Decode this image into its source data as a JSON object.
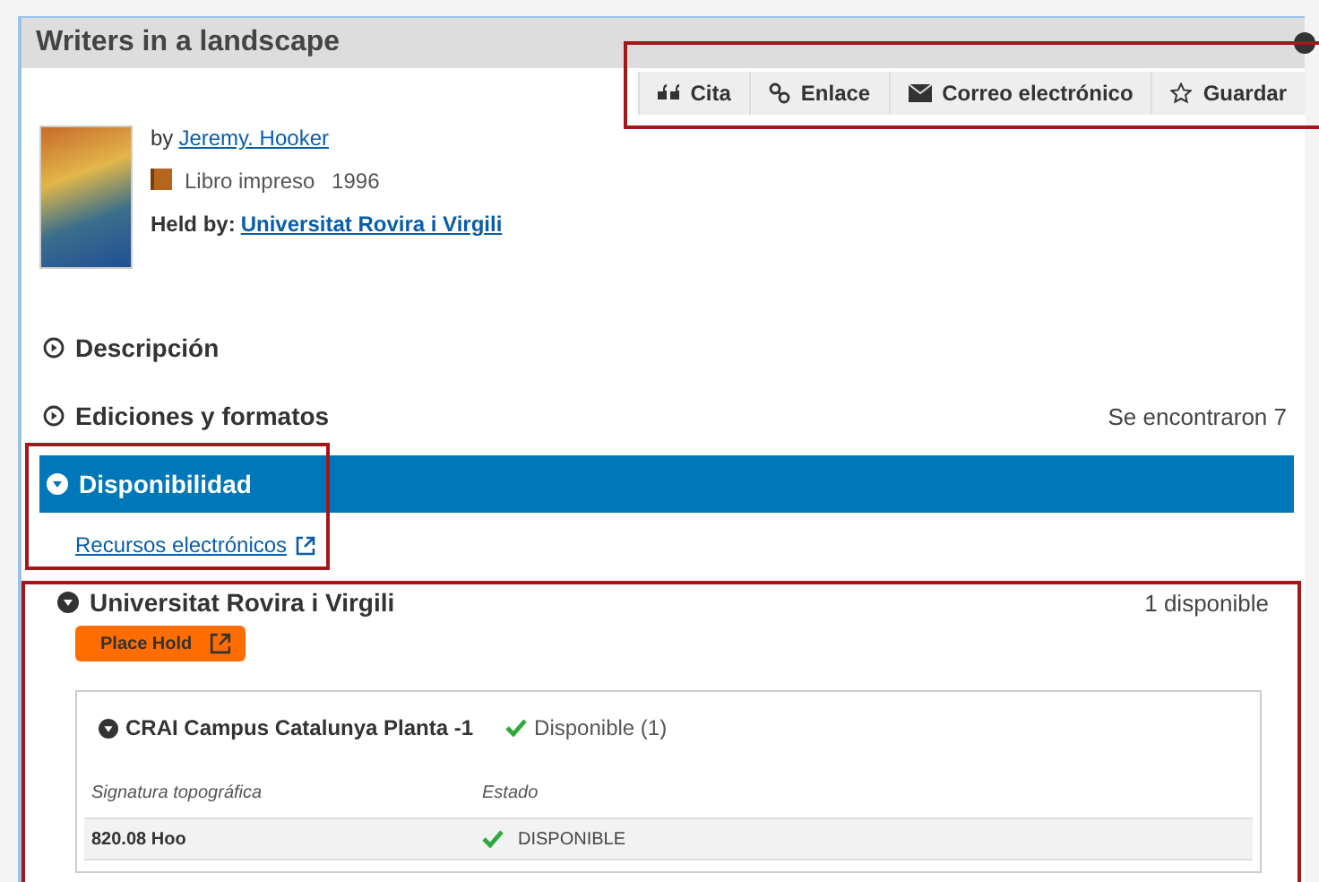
{
  "title": "Writers in a landscape",
  "actions": [
    {
      "label": "Cita",
      "kind": "quote"
    },
    {
      "label": "Enlace",
      "kind": "link"
    },
    {
      "label": "Correo electrónico",
      "kind": "mail"
    },
    {
      "label": "Guardar",
      "kind": "star"
    }
  ],
  "record": {
    "by_prefix": "by",
    "author": "Jeremy. Hooker",
    "format": "Libro impreso",
    "year": "1996",
    "held_by_label": "Held by:",
    "held_by": "Universitat Rovira i Virgili"
  },
  "sections": [
    {
      "label": "Descripción",
      "expanded": false,
      "selected": false
    },
    {
      "label": "Ediciones y formatos",
      "expanded": false,
      "selected": false,
      "count": "Se encontraron 7"
    },
    {
      "label": "Disponibilidad",
      "expanded": true,
      "selected": true
    }
  ],
  "electronic_link": "Recursos electrónicos",
  "library": {
    "name": "Universitat Rovira i Virgili",
    "expanded": true,
    "availability": "1 disponible",
    "hold_button": "Place Hold",
    "location": {
      "name": "CRAI Campus Catalunya Planta -1",
      "expanded": true,
      "status": "Disponible (1)",
      "columns": [
        "Signatura topográfica",
        "Estado"
      ],
      "rows": [
        {
          "call_number": "820.08 Hoo",
          "status": "DISPONIBLE"
        }
      ]
    }
  }
}
